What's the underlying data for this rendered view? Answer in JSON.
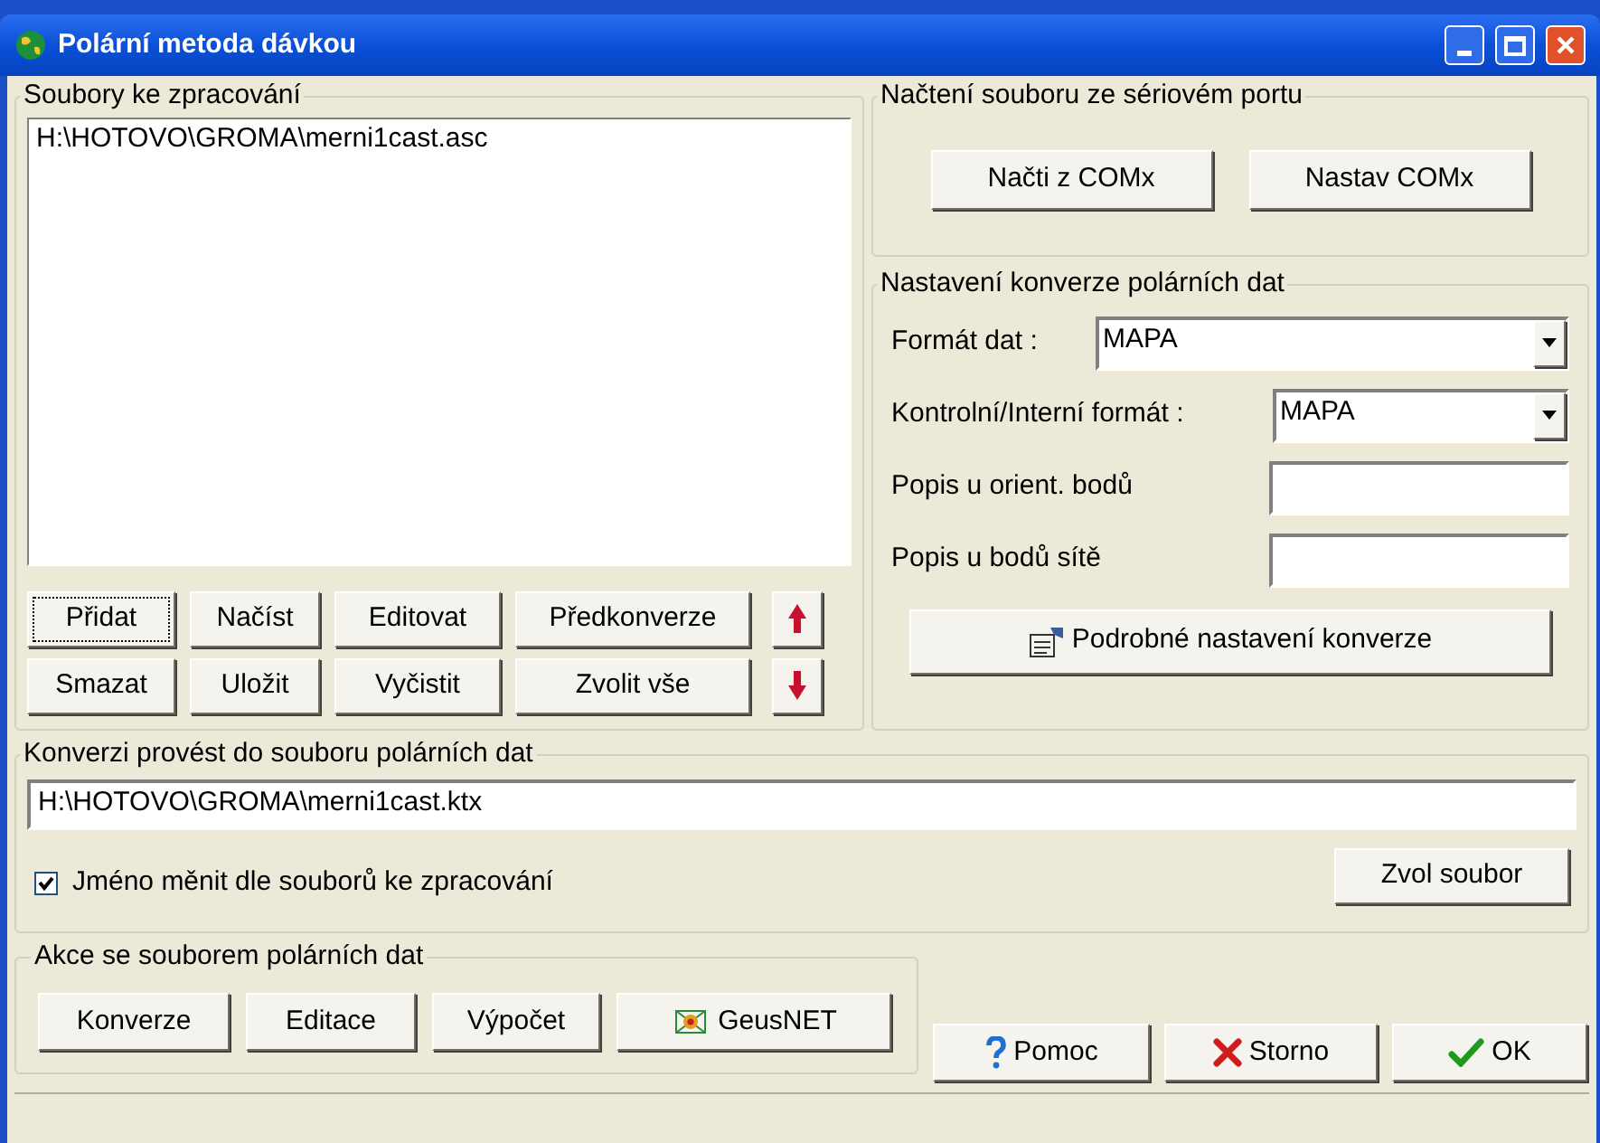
{
  "window": {
    "title": "Polární metoda dávkou"
  },
  "files_group": {
    "legend": "Soubory ke zpracování",
    "items": [
      {
        "text": "H:\\HOTOVO\\GROMA\\merni1cast.asc",
        "selected": false
      }
    ],
    "buttons_row1": [
      {
        "label": "Přidat",
        "focused": true
      },
      {
        "label": "Načíst",
        "focused": false
      },
      {
        "label": "Editovat",
        "focused": false
      },
      {
        "label": "Předkonverze",
        "focused": false
      }
    ],
    "buttons_row2": [
      {
        "label": "Smazat",
        "focused": false
      },
      {
        "label": "Uložit",
        "focused": false
      },
      {
        "label": "Vyčistit",
        "focused": false
      },
      {
        "label": "Zvolit vše",
        "focused": false
      }
    ]
  },
  "serial_group": {
    "legend": "Načtení souboru ze sériovém portu",
    "buttons": [
      "Načti z COMx",
      "Nastav COMx"
    ]
  },
  "conversion_group": {
    "legend": "Nastavení konverze polárních dat",
    "fields": [
      {
        "kind": "select",
        "label": "Formát dat :",
        "value": "MAPA"
      },
      {
        "kind": "select",
        "label": "Kontrolní/Interní formát :",
        "value": "MAPA"
      },
      {
        "kind": "text",
        "label": "Popis u orient. bodů"
      },
      {
        "kind": "text",
        "label": "Popis u bodů sítě"
      }
    ],
    "detail_button": "Podrobné nastavení konverze"
  },
  "output_group": {
    "legend": "Konverzi provést do souboru polárních dat",
    "path": "H:\\HOTOVO\\GROMA\\merni1cast.ktx",
    "checkbox": {
      "label": "Jméno měnit dle souborů ke zpracování",
      "checked": true
    },
    "choose_button": "Zvol soubor"
  },
  "actions_group": {
    "legend": "Akce se souborem polárních dat",
    "buttons": [
      {
        "label": "Konverze",
        "kind": "plain"
      },
      {
        "label": "Editace",
        "kind": "plain"
      },
      {
        "label": "Výpočet",
        "kind": "plain"
      },
      {
        "label": "GeusNET",
        "kind": "network"
      }
    ]
  },
  "dialog_buttons": [
    {
      "label": "Pomoc",
      "kind": "help"
    },
    {
      "label": "Storno",
      "kind": "cancel"
    },
    {
      "label": "OK",
      "kind": "ok"
    }
  ]
}
